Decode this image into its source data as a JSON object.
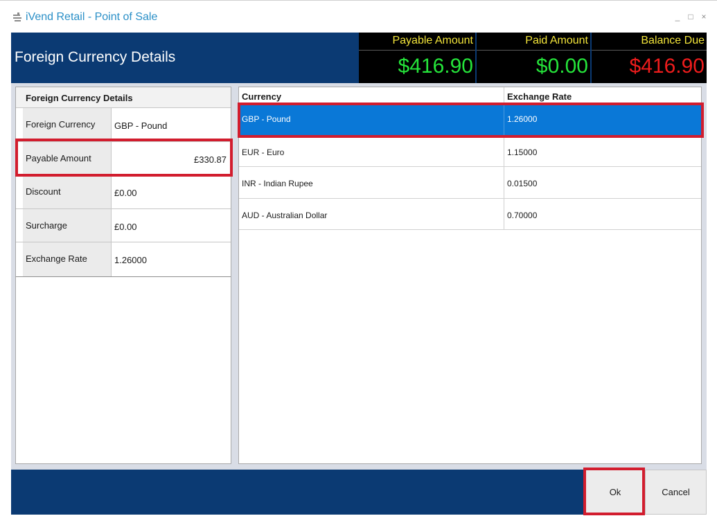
{
  "window": {
    "title": "iVend Retail - Point of Sale",
    "app_icon": "ivend-app-icon",
    "controls": {
      "minimize": "_",
      "maximize": "□",
      "close": "×"
    }
  },
  "header": {
    "title": "Foreign Currency Details",
    "amounts": {
      "payable": {
        "label": "Payable Amount",
        "value": "$416.90"
      },
      "paid": {
        "label": "Paid Amount",
        "value": "$0.00"
      },
      "balance": {
        "label": "Balance Due",
        "value": "$416.90"
      }
    }
  },
  "details": {
    "heading": "Foreign Currency Details",
    "rows": [
      {
        "label": "Foreign Currency",
        "value": "GBP - Pound"
      },
      {
        "label": "Payable Amount",
        "value": "£330.87"
      },
      {
        "label": "Discount",
        "value": "£0.00"
      },
      {
        "label": "Surcharge",
        "value": "£0.00"
      },
      {
        "label": "Exchange Rate",
        "value": "1.26000"
      }
    ]
  },
  "currency_grid": {
    "columns": [
      "Currency",
      "Exchange Rate"
    ],
    "rows": [
      {
        "currency": "GBP - Pound",
        "rate": "1.26000",
        "selected": true
      },
      {
        "currency": "EUR - Euro",
        "rate": "1.15000",
        "selected": false
      },
      {
        "currency": "INR - Indian Rupee",
        "rate": "0.01500",
        "selected": false
      },
      {
        "currency": "AUD - Australian Dollar",
        "rate": "0.70000",
        "selected": false
      }
    ]
  },
  "footer": {
    "ok_label": "Ok",
    "cancel_label": "Cancel"
  },
  "colors": {
    "header_bg": "#0b3a73",
    "amount_label": "#f3e53a",
    "paid_value": "#25e43a",
    "due_value": "#ee1c1c",
    "selection": "#0a78d7",
    "highlight": "#d21d2e"
  }
}
